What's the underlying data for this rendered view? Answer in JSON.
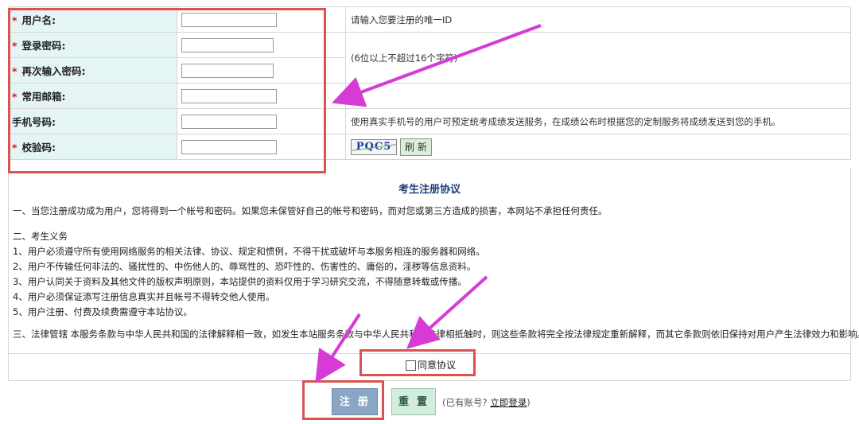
{
  "form": {
    "rows": [
      {
        "required": true,
        "label": "用户名:",
        "hint": "请输入您要注册的唯一ID"
      },
      {
        "required": true,
        "label": "登录密码:",
        "hint": "(6位以上不超过16个字符)"
      },
      {
        "required": true,
        "label": "再次输入密码:"
      },
      {
        "required": true,
        "label": "常用邮箱:"
      },
      {
        "required": false,
        "label": "手机号码:",
        "hint": "使用真实手机号的用户可预定统考成绩发送服务，在成绩公布时根据您的定制服务将成绩发送到您的手机。"
      },
      {
        "required": true,
        "label": "校验码:"
      }
    ],
    "star": "*",
    "captcha_text": "PQC5",
    "refresh_label": "刷 新"
  },
  "agreement": {
    "title": "考生注册协议",
    "para1": "一、当您注册成功成为用户，您将得到一个帐号和密码。如果您未保管好自己的帐号和密码，而对您或第三方造成的损害，本网站不承担任何责任。",
    "para2_heading": "二、考生义务",
    "items": [
      "1、用户必须遵守所有使用网络服务的相关法律、协议、规定和惯例，不得干扰或破坏与本服务相连的服务器和网络。",
      "2、用户不传输任何非法的、骚扰性的、中伤他人的、辱骂性的、恐吓性的、伤害性的、庸俗的，淫秽等信息资料。",
      "3、用户认同关于资料及其他文件的版权声明原则，本站提供的资料仅用于学习研究交流，不得随意转载或传播。",
      "4、用户必须保证添写注册信息真实并且帐号不得转交他人使用。",
      "5、用户注册、付费及续费需遵守本站协议。"
    ],
    "para3": "三、法律管辖 本服务条款与中华人民共和国的法律解释相一致，如发生本站服务条款与中华人民共和国法律相抵触时，则这些条款将完全按法律规定重新解释，而其它条款则依旧保持对用户产生法律效力和影响。",
    "agree_label": "同意协议"
  },
  "buttons": {
    "register": "注册",
    "reset": "重置",
    "have_account": "(已有账号?",
    "login_link": "立即登录",
    "have_account_close": ")"
  },
  "colors": {
    "label_bg": "#e5f4f4",
    "annotation_red": "#d9534f",
    "arrow_magenta": "#d63bd6"
  }
}
